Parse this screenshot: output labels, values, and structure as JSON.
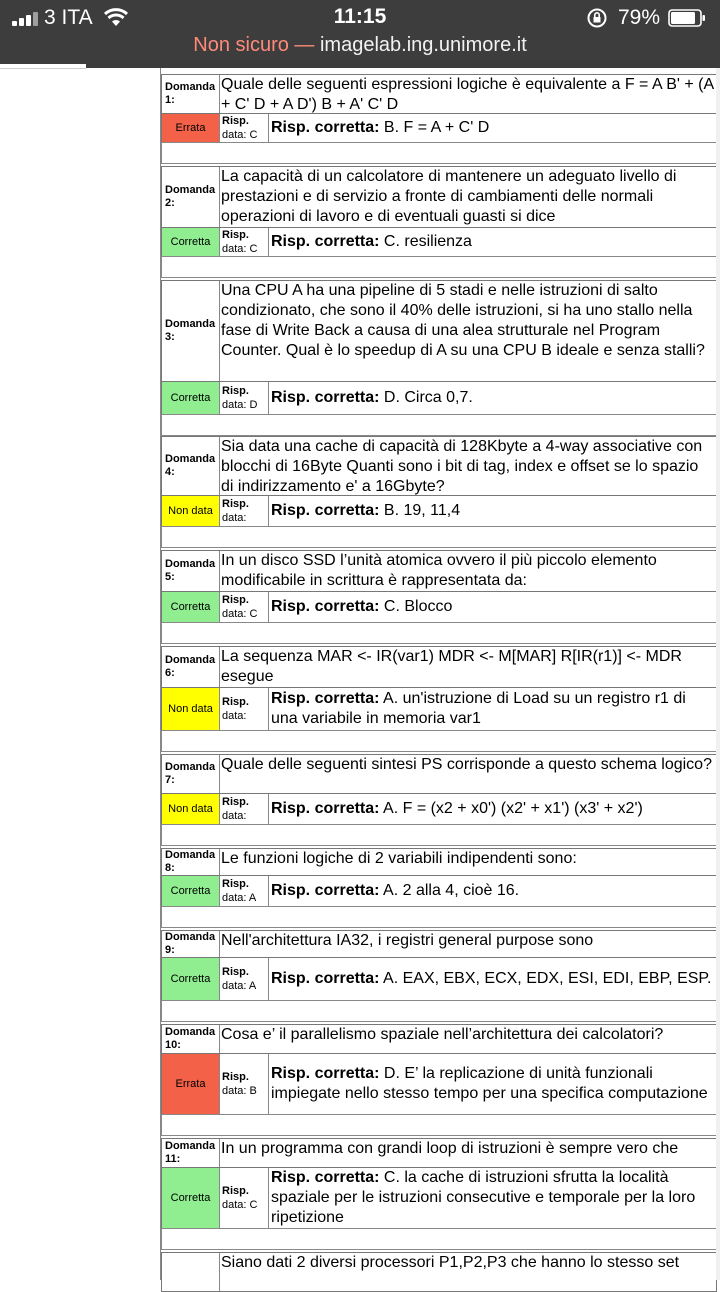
{
  "status_bar": {
    "carrier": "3 ITA",
    "time": "11:15",
    "battery": "79%",
    "icons": [
      "signal-icon",
      "wifi-icon",
      "orientation-lock-icon",
      "battery-icon"
    ]
  },
  "browser": {
    "warning": "Non sicuro —",
    "host": "imagelab.ing.unimore.it"
  },
  "labels": {
    "correct_prefix": "Risp. corretta:",
    "given_prefix": "Risp."
  },
  "questions": [
    {
      "num": "Domanda 1:",
      "text": "Quale delle seguenti espressioni logiche è equivalente a F = A B' + (A + C' D + A D') B + A' C' D",
      "status": "Errata",
      "given": "data: C",
      "correct": "B. F = A + C' D"
    },
    {
      "num": "Domanda 2:",
      "text": "La capacità di un calcolatore di mantenere un adeguato livello di prestazioni e di servizio a fronte di cambiamenti delle normali operazioni di lavoro e di eventuali guasti si dice",
      "status": "Corretta",
      "given": "data: C",
      "correct": "C. resilienza"
    },
    {
      "num": "Domanda 3:",
      "text": "Una CPU A ha una pipeline di 5 stadi e nelle istruzioni di salto condizionato, che sono il 40% delle istruzioni, si ha uno stallo nella fase di Write Back a causa di una alea strutturale nel Program Counter. Qual è lo speedup di A su una CPU B ideale e senza stalli?",
      "status": "Corretta",
      "given": "data: D",
      "correct": "D. Circa 0,7."
    },
    {
      "num": "Domanda 4:",
      "text": "Sia data una cache di capacità di 128Kbyte a 4-way associative con blocchi di 16Byte Quanti sono i bit di tag, index e offset se lo spazio di indirizzamento e' a 16Gbyte?",
      "status": "Non data",
      "given": "data:",
      "correct": "B. 19, 11,4"
    },
    {
      "num": "Domanda 5:",
      "text": "In un disco SSD l’unità atomica ovvero il più piccolo elemento modificabile in scrittura è rappresentata da:",
      "status": "Corretta",
      "given": "data: C",
      "correct": "C. Blocco"
    },
    {
      "num": "Domanda 6:",
      "text": "La sequenza MAR <- IR(var1) MDR <- M[MAR] R[IR(r1)] <- MDR esegue",
      "status": "Non data",
      "given": "data:",
      "correct": "A. un'istruzione di Load su un registro r1 di una variabile in memoria var1"
    },
    {
      "num": "Domanda 7:",
      "text": "Quale delle seguenti sintesi PS corrisponde a questo schema logico?",
      "status": "Non data",
      "given": "data:",
      "correct": "A. F = (x2 + x0') (x2' + x1') (x3' + x2')"
    },
    {
      "num": "Domanda 8:",
      "text": "Le funzioni logiche di 2 variabili indipendenti sono:",
      "status": "Corretta",
      "given": "data: A",
      "correct": "A. 2 alla 4, cioè 16."
    },
    {
      "num": "Domanda 9:",
      "text": "Nell'architettura IA32, i registri general purpose sono",
      "status": "Corretta",
      "given": "data: A",
      "correct": "A. EAX, EBX, ECX, EDX, ESI, EDI, EBP, ESP."
    },
    {
      "num": "Domanda 10:",
      "text": "Cosa e’ il parallelismo spaziale nell’architettura dei calcolatori?",
      "status": "Errata",
      "given": "data: B",
      "correct": "D. E’ la replicazione di unità funzionali impiegate nello stesso tempo per una specifica computazione"
    },
    {
      "num": "Domanda 11:",
      "text": "In un programma con grandi loop di istruzioni è sempre vero che",
      "status": "Corretta",
      "given": "data: C",
      "correct": "C. la cache di istruzioni sfrutta la località spaziale per le istruzioni consecutive e temporale per la loro ripetizione"
    },
    {
      "num": "",
      "text": "Siano dati 2 diversi processori P1,P2,P3 che hanno lo stesso set",
      "status": "",
      "given": "",
      "correct": ""
    }
  ]
}
